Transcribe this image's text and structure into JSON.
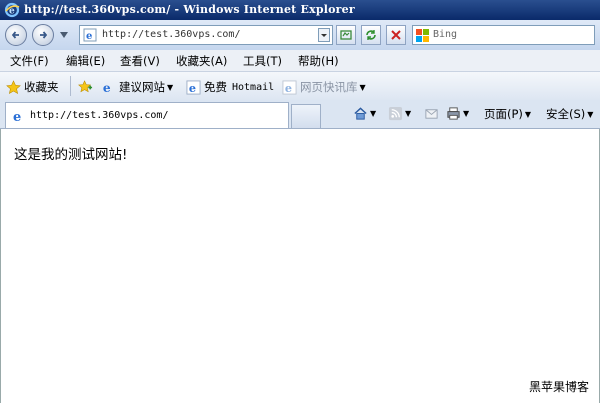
{
  "window": {
    "title": "http://test.360vps.com/ - Windows Internet Explorer"
  },
  "navigation": {
    "address_value": "http://test.360vps.com/",
    "search_placeholder": "Bing"
  },
  "menu": {
    "items": [
      "文件(F)",
      "编辑(E)",
      "查看(V)",
      "收藏夹(A)",
      "工具(T)",
      "帮助(H)"
    ]
  },
  "favorites": {
    "button_label": "收藏夹",
    "items": [
      "建议网站",
      "免费",
      "Hotmail",
      "网页快讯库"
    ]
  },
  "tabs": {
    "active_title": "http://test.360vps.com/"
  },
  "commands": {
    "page_label": "页面(P)",
    "safety_label": "安全(S)"
  },
  "content": {
    "message": "这是我的测试网站!"
  },
  "watermark": "黑苹果博客",
  "colors": {
    "titlebar": "#0a2a6a",
    "toolbar": "#dbe5f2",
    "accent": "#2a6fd6"
  }
}
